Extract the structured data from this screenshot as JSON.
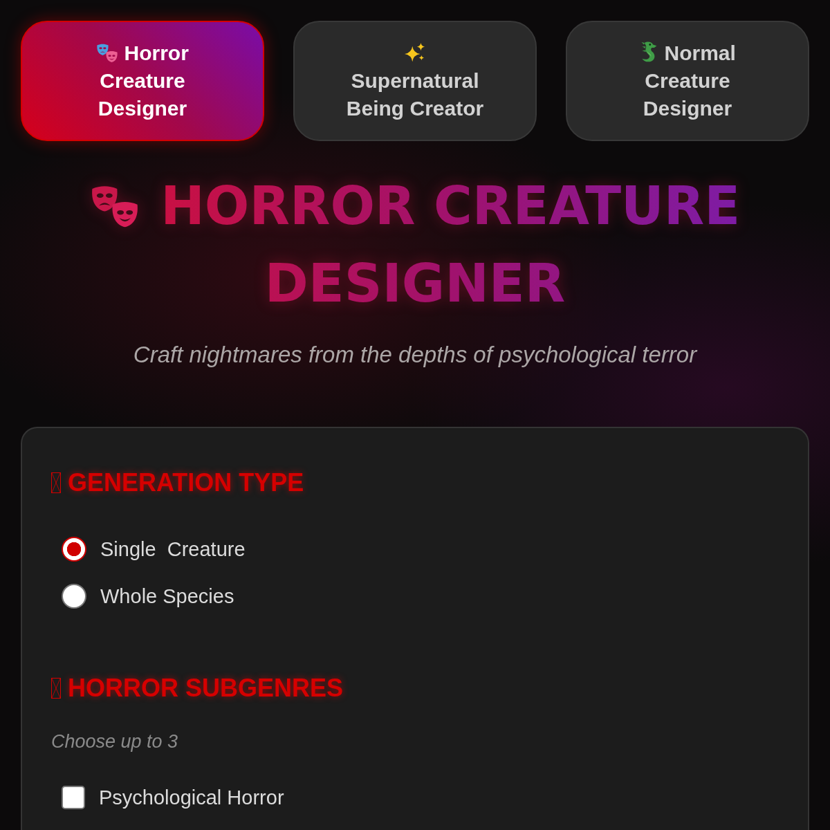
{
  "tabs": [
    {
      "label": "Horror Creature Designer",
      "selected": true
    },
    {
      "label": "Supernatural Being Creator",
      "selected": false
    },
    {
      "label": "Normal Creature Designer",
      "selected": false
    }
  ],
  "header": {
    "title": "HORROR CREATURE DESIGNER",
    "subtitle": "Craft nightmares from the depths of psychological terror"
  },
  "sections": [
    {
      "title": "GENERATION TYPE",
      "kind": "radio",
      "options": [
        {
          "label": "Single  Creature",
          "selected": true
        },
        {
          "label": "Whole Species",
          "selected": false
        }
      ]
    },
    {
      "title": "HORROR SUBGENRES",
      "kind": "checkbox",
      "hint": "Choose up to 3",
      "options": [
        {
          "label": "Psychological Horror",
          "checked": false
        }
      ]
    }
  ]
}
